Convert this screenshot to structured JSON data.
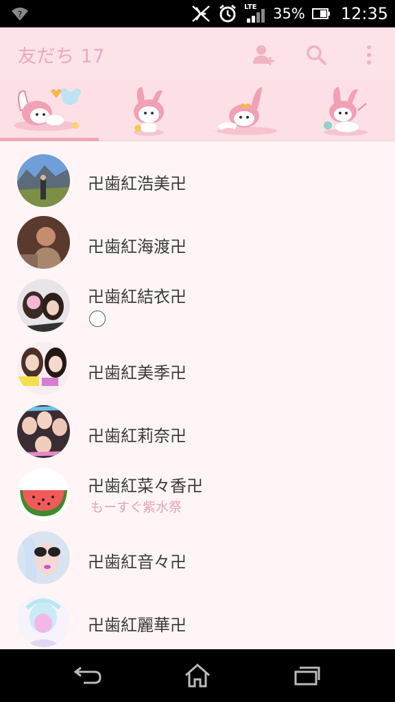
{
  "status_bar": {
    "battery_percent": "35%",
    "time": "12:35",
    "network_label": "LTE",
    "icons": [
      "wifi-icon",
      "mute-icon",
      "alarm-icon",
      "signal-icon",
      "battery-icon"
    ]
  },
  "app_bar": {
    "title": "友だち 17",
    "actions": [
      "add-friend-icon",
      "search-icon",
      "overflow-menu-icon"
    ]
  },
  "tabs": {
    "count": 4,
    "selected_index": 0,
    "icons": [
      "sticker-tab-1-icon",
      "sticker-tab-2-icon",
      "sticker-tab-3-icon",
      "sticker-tab-4-icon"
    ]
  },
  "friends": [
    {
      "name": "卍歯紅浩美卍",
      "status": ""
    },
    {
      "name": "卍歯紅海渡卍",
      "status": ""
    },
    {
      "name": "卍歯紅結衣卍",
      "status": ""
    },
    {
      "name": "卍歯紅美季卍",
      "status": ""
    },
    {
      "name": "卍歯紅莉奈卍",
      "status": ""
    },
    {
      "name": "卍歯紅菜々香卍",
      "status": "もーすぐ紫水祭"
    },
    {
      "name": "卍歯紅音々卍",
      "status": ""
    },
    {
      "name": "卍歯紅麗華卍",
      "status": ""
    }
  ],
  "colors": {
    "accent": "#ebaab8",
    "app_bar_bg": "#fde3e8",
    "list_bg": "#fff5f6",
    "status_text": "#e5a2b5"
  },
  "nav_bar": {
    "icons": [
      "back-icon",
      "home-icon",
      "recents-icon"
    ]
  }
}
